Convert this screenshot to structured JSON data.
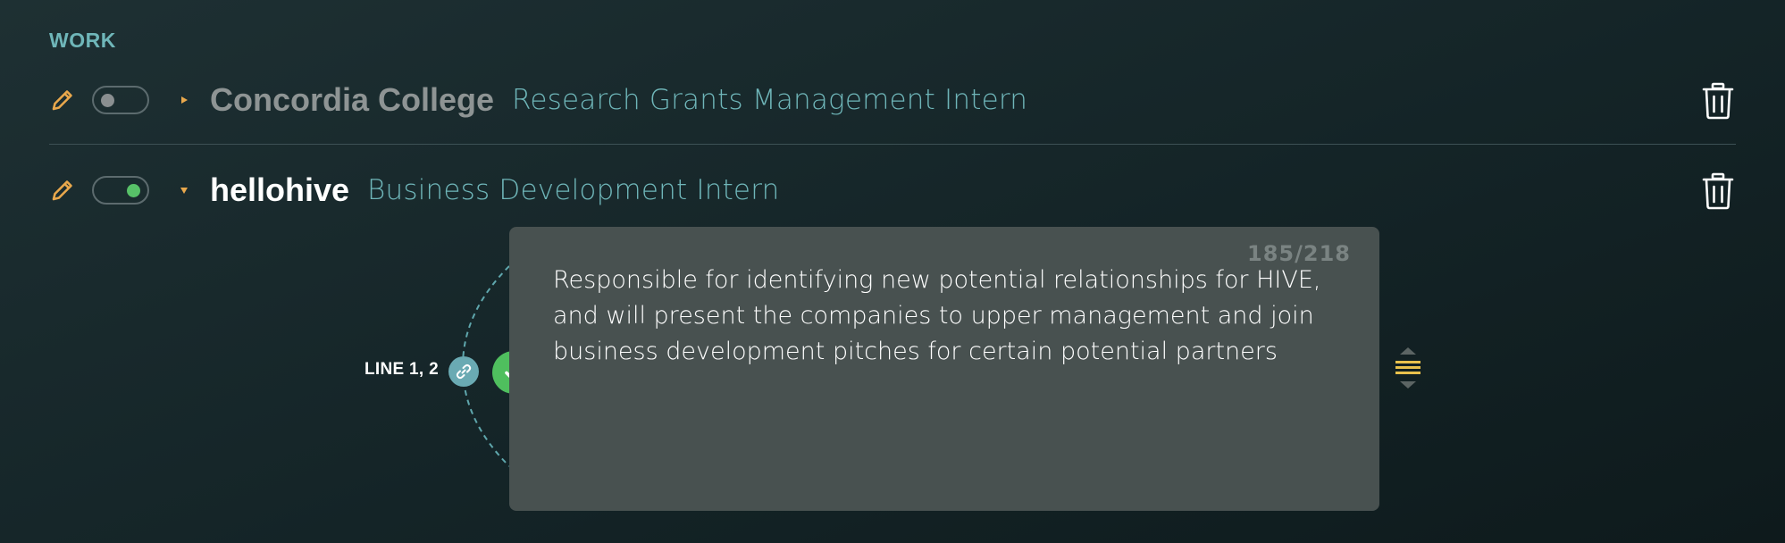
{
  "section": {
    "title": "WORK"
  },
  "entries": [
    {
      "company": "Concordia College",
      "role": "Research Grants Management Intern",
      "enabled": false,
      "expanded": false
    },
    {
      "company": "hellohive",
      "role": "Business Development Intern",
      "enabled": true,
      "expanded": true
    }
  ],
  "editor": {
    "line_label": "LINE 1, 2",
    "char_count": "185/218",
    "text": "Responsible for identifying new potential relationships for HIVE, and will present the companies to upper management and join business development pitches for certain potential partners"
  },
  "icons": {
    "edit": "pencil-icon",
    "delete": "trash-icon",
    "link": "link-icon",
    "confirm": "check-icon",
    "drag": "drag-handle-icon"
  },
  "colors": {
    "accent_teal": "#6fb6b9",
    "accent_orange": "#e9a84c",
    "toggle_on": "#57c168",
    "editor_bg": "#485150"
  }
}
